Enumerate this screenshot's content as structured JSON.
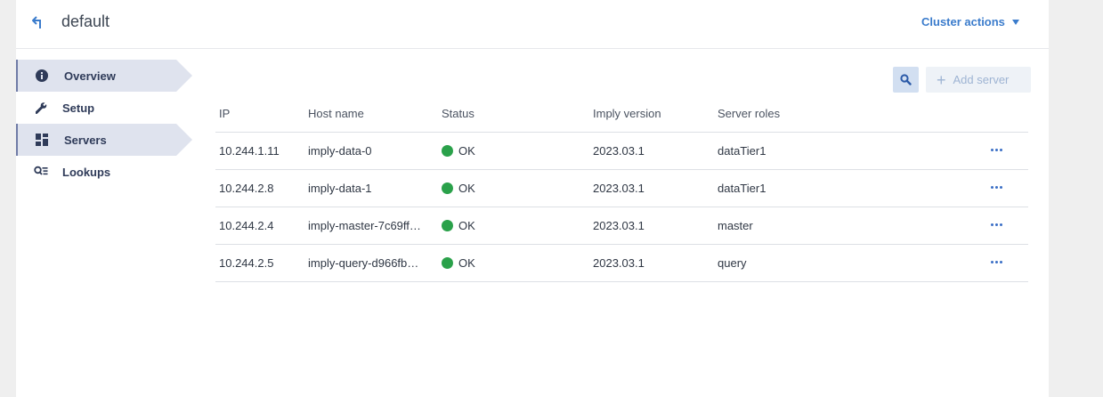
{
  "header": {
    "title": "default",
    "cluster_actions_label": "Cluster actions"
  },
  "sidebar": {
    "items": [
      {
        "label": "Overview",
        "icon": "info-icon",
        "active": true
      },
      {
        "label": "Setup",
        "icon": "wrench-icon",
        "active": false
      },
      {
        "label": "Servers",
        "icon": "dashboard-grid-icon",
        "active": true
      },
      {
        "label": "Lookups",
        "icon": "search-list-icon",
        "active": false
      }
    ]
  },
  "toolbar": {
    "search_icon": "search-icon",
    "add_server_label": "Add server"
  },
  "table": {
    "columns": [
      "IP",
      "Host name",
      "Status",
      "Imply version",
      "Server roles"
    ],
    "rows": [
      {
        "ip": "10.244.1.11",
        "host": "imply-data-0",
        "status": "OK",
        "version": "2023.03.1",
        "roles": "dataTier1"
      },
      {
        "ip": "10.244.2.8",
        "host": "imply-data-1",
        "status": "OK",
        "version": "2023.03.1",
        "roles": "dataTier1"
      },
      {
        "ip": "10.244.2.4",
        "host": "imply-master-7c69ff…",
        "status": "OK",
        "version": "2023.03.1",
        "roles": "master"
      },
      {
        "ip": "10.244.2.5",
        "host": "imply-query-d966fb…",
        "status": "OK",
        "version": "2023.03.1",
        "roles": "query"
      }
    ]
  },
  "colors": {
    "accent": "#3b7ccc",
    "status_ok": "#2aa14a",
    "active_nav_bg": "#dfe3ee"
  }
}
